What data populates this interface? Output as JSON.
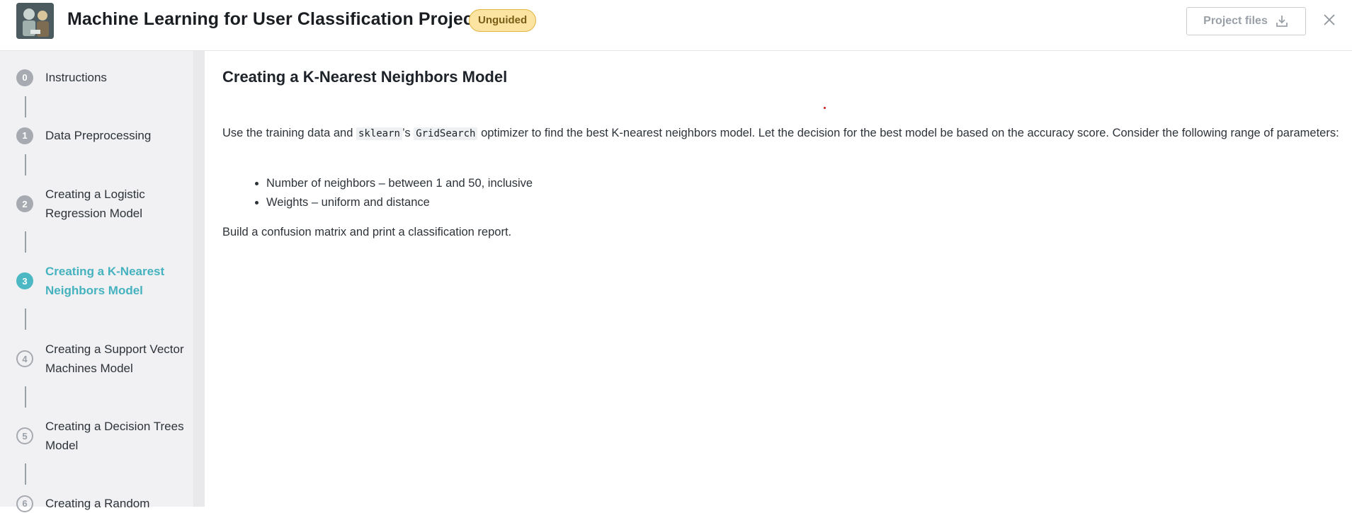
{
  "header": {
    "title": "Machine Learning for User Classification Project",
    "badge": "Unguided",
    "files_button": "Project files",
    "thumbnail_icon": "project-thumbnail",
    "download_icon": "download-icon",
    "close_icon": "close-icon"
  },
  "sidebar": {
    "steps": [
      {
        "num": "0",
        "label": "Instructions",
        "state": "done"
      },
      {
        "num": "1",
        "label": "Data Preprocessing",
        "state": "done"
      },
      {
        "num": "2",
        "label": "Creating a Logistic Regression Model",
        "state": "done"
      },
      {
        "num": "3",
        "label": "Creating a K-Nearest Neighbors Model",
        "state": "active"
      },
      {
        "num": "4",
        "label": "Creating a Support Vector Machines Model",
        "state": "todo"
      },
      {
        "num": "5",
        "label": "Creating a Decision Trees Model",
        "state": "todo"
      },
      {
        "num": "6",
        "label": "Creating a Random",
        "state": "todo"
      }
    ]
  },
  "content": {
    "heading": "Creating a K-Nearest Neighbors Model",
    "para_part1": "Use the training data and ",
    "code1": "sklearn",
    "para_part2": "’s ",
    "code2": "GridSearch",
    "para_part3": " optimizer to find the best K-nearest neighbors model. Let the decision for the best model be based on the accuracy score. Consider the following range of parameters:",
    "bullets": [
      "Number of neighbors – between 1 and 50, inclusive",
      "Weights – uniform and distance"
    ],
    "closing": "Build a confusion matrix and print a classification report."
  },
  "colors": {
    "accent": "#4cb8c4",
    "badge_bg": "#fbe3a1",
    "badge_border": "#e0b541"
  }
}
